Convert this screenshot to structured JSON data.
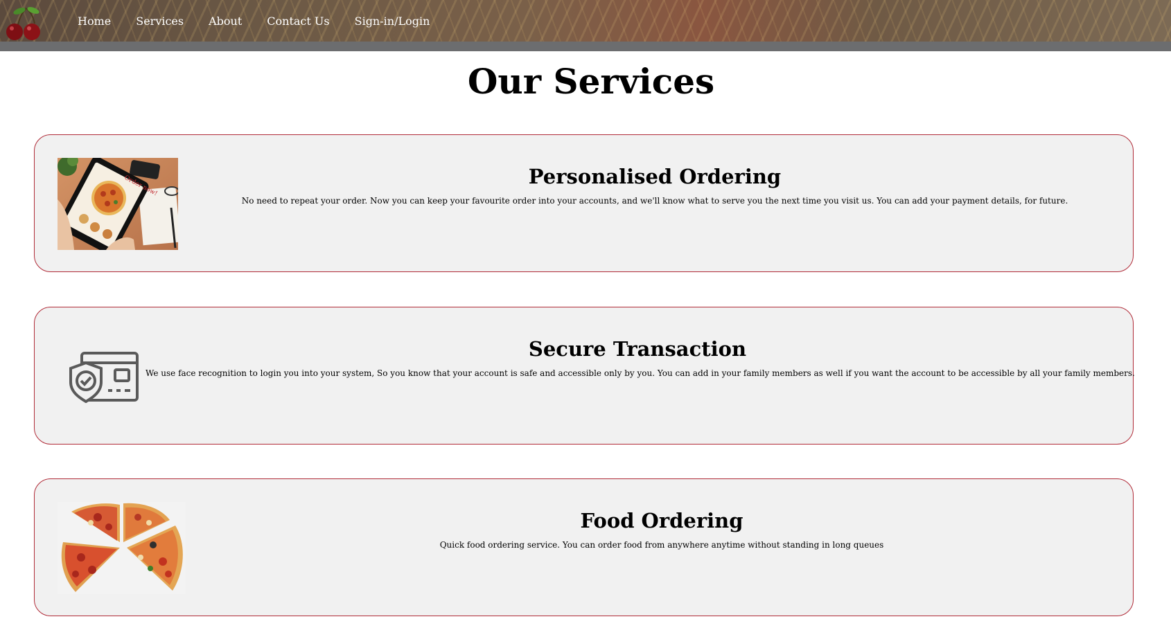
{
  "nav": {
    "logo": "cherry-logo",
    "items": [
      {
        "label": "Home"
      },
      {
        "label": "Services"
      },
      {
        "label": "About"
      },
      {
        "label": "Contact Us"
      },
      {
        "label": "Sign-in/Login"
      }
    ]
  },
  "page": {
    "title": "Our Services"
  },
  "services": [
    {
      "title": "Personalised Ordering",
      "description": "No need to repeat your order. Now you can keep your favourite order into your accounts, and we'll know what to serve you the next time you visit us. You can add your payment details, for future.",
      "image": "tablet-ordering-image"
    },
    {
      "title": "Secure Transaction",
      "description": "We use face recognition to login you into your system, So you know that your account is safe and accessible only by you. You can add in your family members as well if you want the account to be accessible by all your family members.",
      "image": "secure-card-icon"
    },
    {
      "title": "Food Ordering",
      "description": "Quick food ordering service. You can order food from anywhere anytime without standing in long queues",
      "image": "pizza-slices-image"
    }
  ],
  "colors": {
    "card_border": "#b02a37",
    "card_background": "#f1f1f1",
    "nav_text": "#ffffff",
    "strip": "#6c6d6f"
  }
}
